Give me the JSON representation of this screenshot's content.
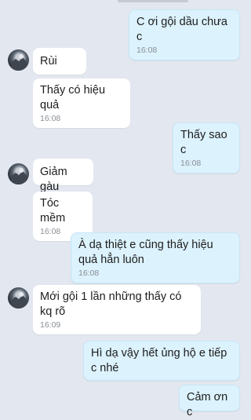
{
  "messages": [
    {
      "text": "C ơi gội dầu chưa c",
      "time": "16:08"
    },
    {
      "text": "Rùi"
    },
    {
      "text": "Thấy có hiệu quả",
      "time": "16:08"
    },
    {
      "text": "Thấy sao c",
      "time": "16:08"
    },
    {
      "text": "Giảm gàu"
    },
    {
      "text": "Tóc mềm",
      "time": "16:08"
    },
    {
      "text": "À dạ thiệt e cũng thấy hiệu quả hẳn luôn",
      "time": "16:08"
    },
    {
      "text": "Mới gội 1 lần những thấy có kq rõ",
      "time": "16:09"
    },
    {
      "text": "Hì dạ vậy hết ủng hộ e tiếp c nhé"
    },
    {
      "text": "Cảm ơn c"
    }
  ],
  "icons": {
    "avatar": "contact-avatar-icon"
  },
  "colors": {
    "background": "#e3e7ef",
    "incoming": "#ffffff",
    "outgoing": "#dcf2fd"
  }
}
